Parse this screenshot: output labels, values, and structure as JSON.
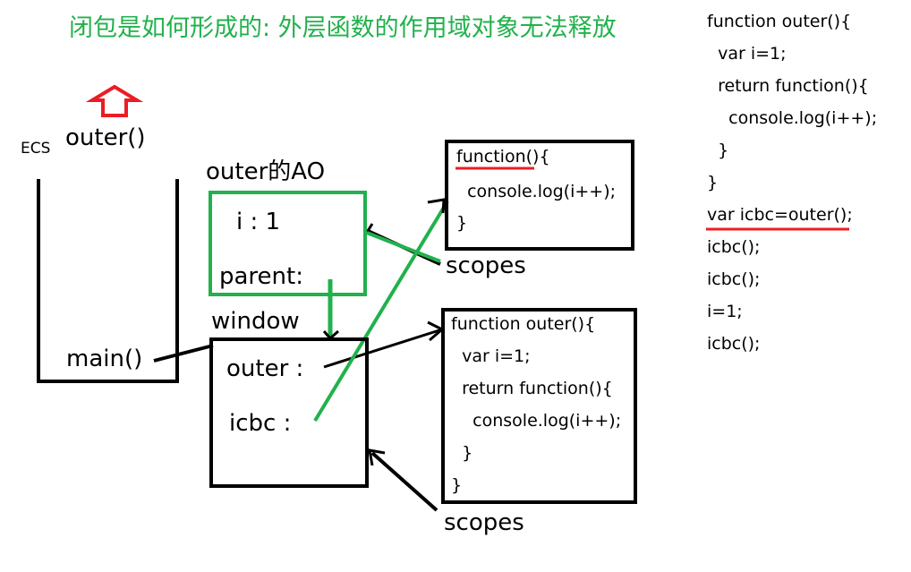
{
  "title": "闭包是如何形成的: 外层函数的作用域对象无法释放",
  "stack": {
    "label": "ECS",
    "top_frame": "outer()",
    "bottom_frame": "main()"
  },
  "ao": {
    "label": "outer的AO",
    "var_i": "i : 1",
    "parent": "parent:"
  },
  "window": {
    "label": "window",
    "outer": "outer :",
    "icbc": "icbc :"
  },
  "inner_fn_box": {
    "lines": [
      "function(){",
      "  console.log(i++);",
      "}"
    ]
  },
  "outer_fn_box": {
    "lines": [
      "function outer(){",
      "  var i=1;",
      "  return function(){",
      "    console.log(i++);",
      "  }",
      "}"
    ]
  },
  "scopes_labels": [
    "scopes",
    "scopes"
  ],
  "code_listing": [
    "function outer(){",
    "  var i=1;",
    "  return function(){",
    "    console.log(i++);",
    "  }",
    "}",
    "var icbc=outer();",
    "icbc();",
    "icbc();",
    "i=1;",
    "icbc();"
  ],
  "colors": {
    "title": "#22b14c",
    "ao_border": "#22b14c",
    "scope_link": "#22b14c",
    "underline": "#ed1c24",
    "arrow_up": "#ed1c24",
    "ink": "#000000"
  },
  "icons": {
    "pop_arrow": "up-arrow-icon"
  }
}
